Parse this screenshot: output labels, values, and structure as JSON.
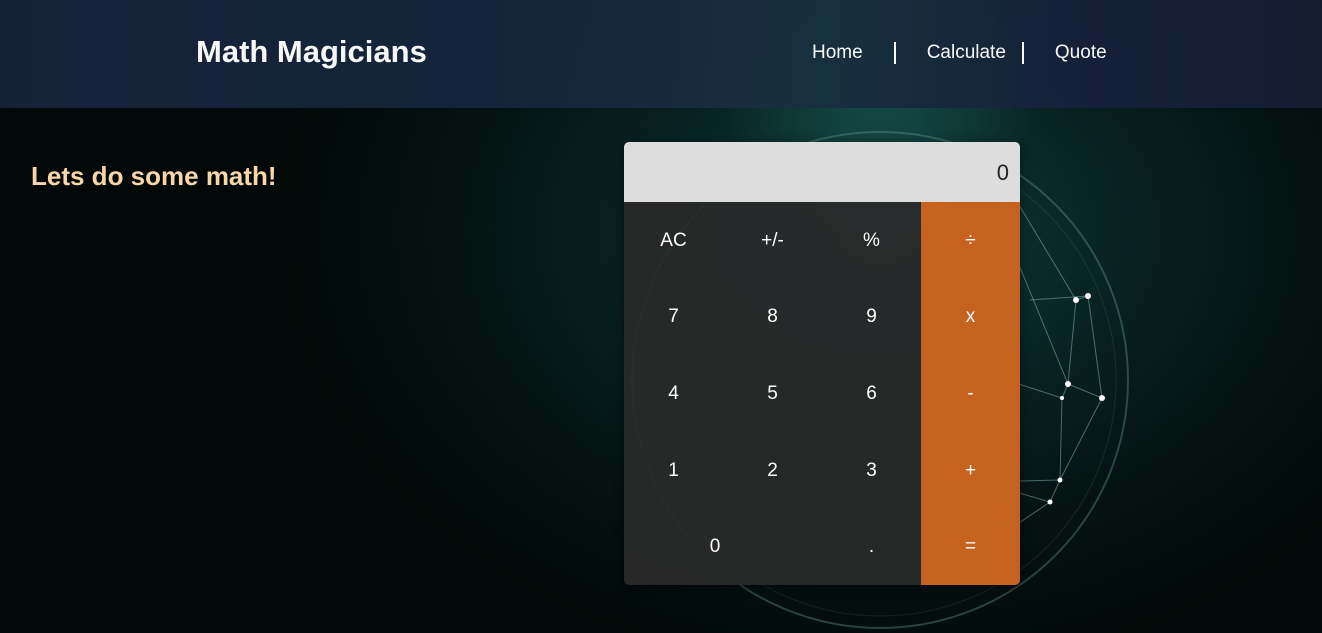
{
  "header": {
    "title": "Math Magicians",
    "nav": [
      "Home",
      "Calculate",
      "Quote"
    ]
  },
  "main": {
    "tagline": "Lets do some math!"
  },
  "calculator": {
    "display": "0",
    "keys": [
      "AC",
      "+/-",
      "%",
      "÷",
      "7",
      "8",
      "9",
      "x",
      "4",
      "5",
      "6",
      "-",
      "1",
      "2",
      "3",
      "+",
      "0",
      ".",
      "="
    ]
  },
  "colors": {
    "header_bg": "#16223a",
    "accent": "#d8681e",
    "tagline": "#f7d6a8",
    "display_bg": "#dddddd",
    "keypad_bg": "#2a2a2a"
  }
}
